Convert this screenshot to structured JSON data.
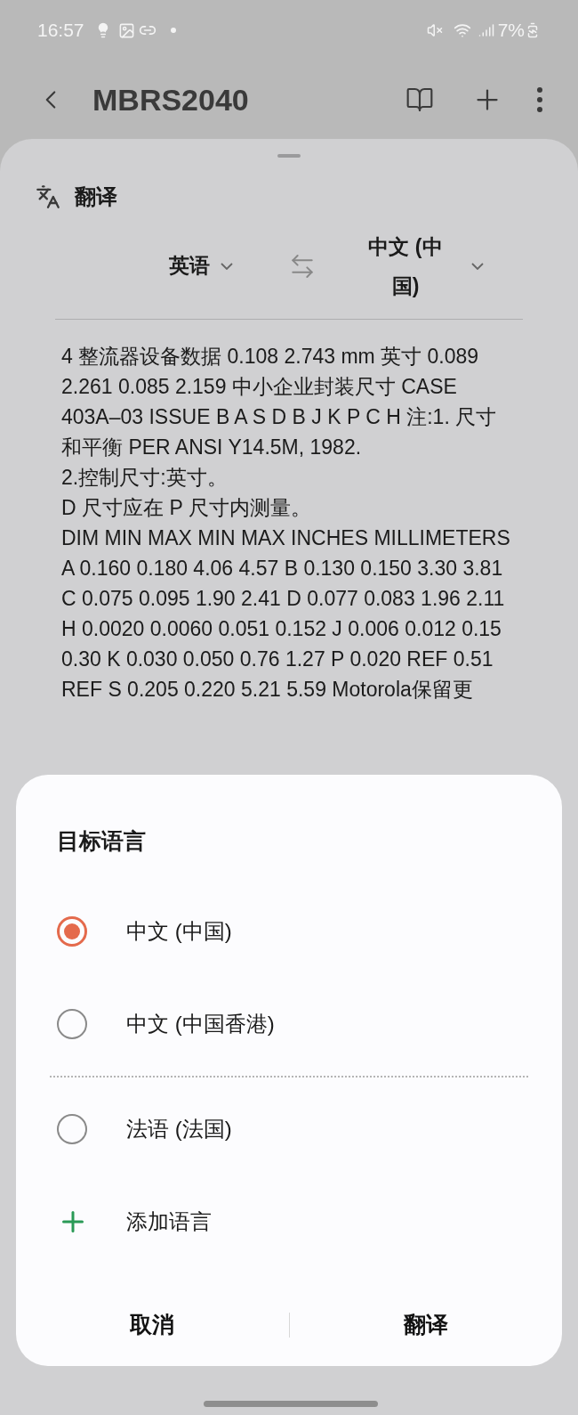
{
  "status_bar": {
    "time": "16:57",
    "battery": "7%"
  },
  "app_bar": {
    "title": "MBRS2040"
  },
  "translate_sheet": {
    "title": "翻译",
    "source_language": "英语",
    "target_language": "中文 (中国)",
    "paragraphs": [
      "4 整流器设备数据 0.108 2.743 mm 英寸 0.089 2.261 0.085 2.159 中小企业封装尺寸 CASE 403A–03 ISSUE B A S D B J K P C H 注:1. 尺寸和平衡 PER ANSI Y14.5M, 1982.",
      "2.控制尺寸:英寸。",
      "D 尺寸应在 P 尺寸内测量。",
      "DIM MIN MAX MIN MAX INCHES MILLIMETERS A 0.160 0.180 4.06 4.57 B 0.130 0.150 3.30 3.81 C 0.075 0.095 1.90 2.41 D 0.077 0.083 1.96 2.11 H 0.0020 0.0060 0.051 0.152 J 0.006 0.012 0.15 0.30 K 0.030 0.050 0.76 1.27 P 0.020 REF 0.51 REF S 0.205 0.220 5.21 5.59 Motorola保留更"
    ]
  },
  "dialog": {
    "title": "目标语言",
    "options": [
      {
        "kind": "radio",
        "label": "中文 (中国)",
        "selected": true
      },
      {
        "kind": "radio",
        "label": "中文 (中国香港)",
        "selected": false
      },
      {
        "kind": "divider"
      },
      {
        "kind": "radio",
        "label": "法语 (法国)",
        "selected": false
      },
      {
        "kind": "add",
        "label": "添加语言"
      }
    ],
    "buttons": [
      "取消",
      "翻译"
    ]
  }
}
